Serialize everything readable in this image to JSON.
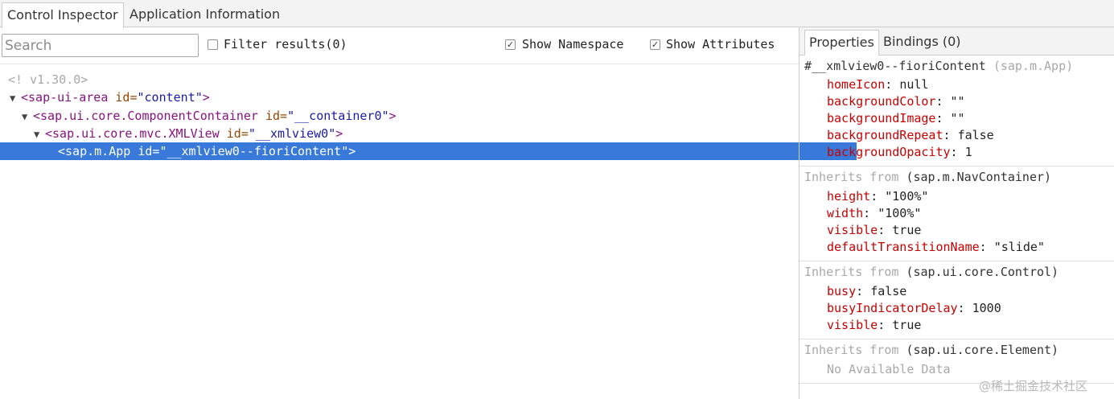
{
  "top_tabs": [
    "Control Inspector",
    "Application Information"
  ],
  "toolbar": {
    "search_placeholder": "Search",
    "filter_label": "Filter results(0)",
    "filter_checked": false,
    "show_namespace_label": "Show Namespace",
    "show_namespace_checked": true,
    "show_attributes_label": "Show Attributes",
    "show_attributes_checked": true
  },
  "tree": {
    "version_comment": "<! v1.30.0>",
    "nodes": [
      {
        "tag": "<sap-ui-area",
        "attr": "id=",
        "value": "\"content\"",
        "close": ">"
      },
      {
        "tag": "<sap.ui.core.ComponentContainer",
        "attr": "id=",
        "value": "\"__container0\"",
        "close": ">"
      },
      {
        "tag": "<sap.ui.core.mvc.XMLView",
        "attr": "id=",
        "value": "\"__xmlview0\"",
        "close": ">"
      },
      {
        "tag": "<sap.m.App",
        "attr": "id=",
        "value": "\"__xmlview0--fioriContent\"",
        "close": ">"
      }
    ]
  },
  "right_tabs": [
    "Properties",
    "Bindings (0)"
  ],
  "properties": {
    "header_id": "#__xmlview0--fioriContent",
    "header_type": "(sap.m.App)",
    "own": [
      {
        "name": "homeIcon",
        "value": "null"
      },
      {
        "name": "backgroundColor",
        "value": "\"\""
      },
      {
        "name": "backgroundImage",
        "value": "\"\""
      },
      {
        "name": "backgroundRepeat",
        "value": "false"
      },
      {
        "name": "backgroundOpacity",
        "value": "1"
      }
    ],
    "inherits_label": "Inherits from",
    "inherited": [
      {
        "from": "(sap.m.NavContainer)",
        "props": [
          {
            "name": "height",
            "value": "\"100%\""
          },
          {
            "name": "width",
            "value": "\"100%\""
          },
          {
            "name": "visible",
            "value": "true"
          },
          {
            "name": "defaultTransitionName",
            "value": "\"slide\""
          }
        ]
      },
      {
        "from": "(sap.ui.core.Control)",
        "props": [
          {
            "name": "busy",
            "value": "false"
          },
          {
            "name": "busyIndicatorDelay",
            "value": "1000"
          },
          {
            "name": "visible",
            "value": "true"
          }
        ]
      },
      {
        "from": "(sap.ui.core.Element)",
        "no_data": "No Available Data"
      }
    ]
  },
  "watermark": "@稀土掘金技术社区",
  "colors": {
    "selection": "#3879d9",
    "tag": "#881280",
    "attribute": "#994500",
    "value": "#1a1aa6",
    "property_name": "#c80000"
  }
}
